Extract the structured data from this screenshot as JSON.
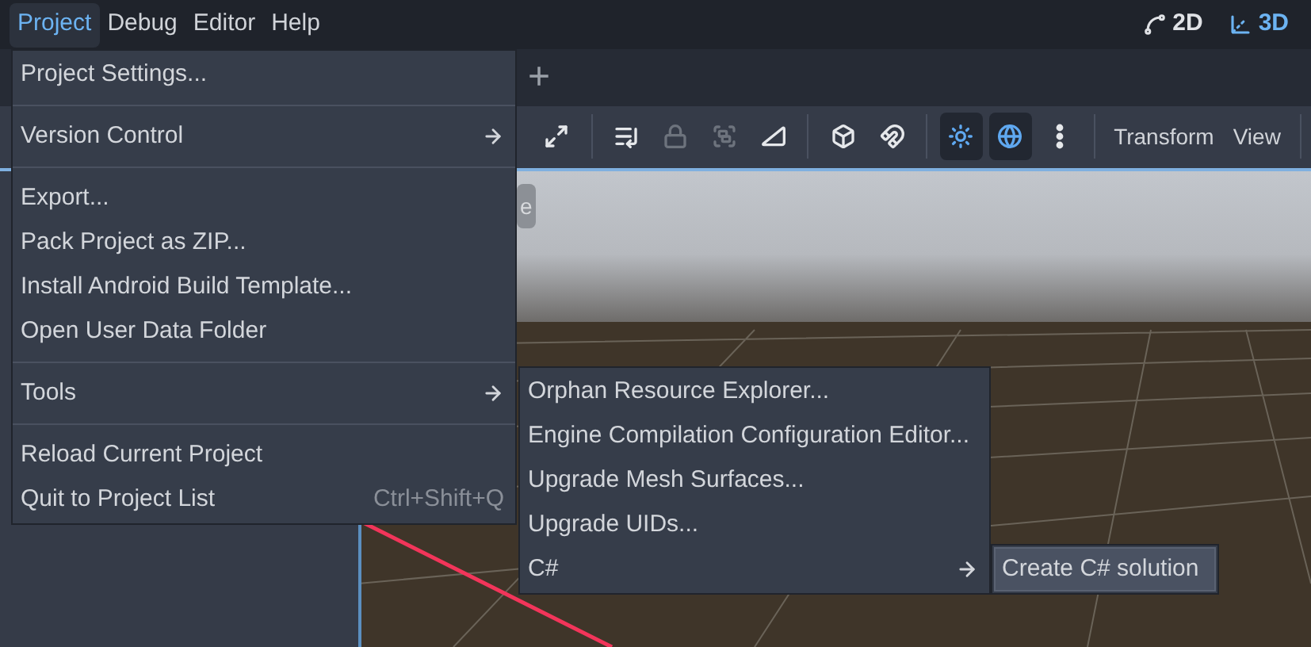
{
  "menubar": {
    "items": [
      {
        "label": "Project",
        "selected": true
      },
      {
        "label": "Debug",
        "selected": false
      },
      {
        "label": "Editor",
        "selected": false
      },
      {
        "label": "Help",
        "selected": false
      }
    ]
  },
  "view_modes": [
    {
      "label": "2D",
      "selected": false
    },
    {
      "label": "3D",
      "selected": true
    }
  ],
  "tab_strip": {
    "add_label": "+"
  },
  "toolbar": {
    "tool_groups": [
      [
        {
          "kind": "expand",
          "on": false,
          "disabled": false
        }
      ],
      [
        {
          "kind": "select-list",
          "on": false,
          "disabled": false
        },
        {
          "kind": "lock",
          "on": false,
          "disabled": true
        },
        {
          "kind": "group",
          "on": false,
          "disabled": true
        },
        {
          "kind": "ruler",
          "on": false,
          "disabled": false
        }
      ],
      [
        {
          "kind": "cube",
          "on": false,
          "disabled": false
        },
        {
          "kind": "magnet",
          "on": false,
          "disabled": false
        }
      ],
      [
        {
          "kind": "sun",
          "on": true,
          "disabled": false
        },
        {
          "kind": "globe",
          "on": true,
          "disabled": false
        },
        {
          "kind": "more",
          "on": false,
          "disabled": false
        }
      ]
    ],
    "menus": [
      "Transform",
      "View"
    ]
  },
  "viewport": {
    "label": "e"
  },
  "project_menu": {
    "items": [
      {
        "kind": "item",
        "label": "Project Settings..."
      },
      {
        "kind": "separator"
      },
      {
        "kind": "submenu",
        "label": "Version Control"
      },
      {
        "kind": "separator"
      },
      {
        "kind": "item",
        "label": "Export..."
      },
      {
        "kind": "item",
        "label": "Pack Project as ZIP..."
      },
      {
        "kind": "item",
        "label": "Install Android Build Template..."
      },
      {
        "kind": "item",
        "label": "Open User Data Folder"
      },
      {
        "kind": "separator"
      },
      {
        "kind": "submenu",
        "label": "Tools"
      },
      {
        "kind": "separator"
      },
      {
        "kind": "item",
        "label": "Reload Current Project"
      },
      {
        "kind": "item",
        "label": "Quit to Project List",
        "shortcut": "Ctrl+Shift+Q"
      }
    ]
  },
  "tools_menu": {
    "items": [
      {
        "kind": "item",
        "label": "Orphan Resource Explorer..."
      },
      {
        "kind": "item",
        "label": "Engine Compilation Configuration Editor..."
      },
      {
        "kind": "item",
        "label": "Upgrade Mesh Surfaces..."
      },
      {
        "kind": "item",
        "label": "Upgrade UIDs..."
      },
      {
        "kind": "submenu",
        "label": "C#"
      }
    ]
  },
  "csharp_menu": {
    "items": [
      {
        "kind": "item",
        "label": "Create C# solution",
        "selected": true
      }
    ]
  }
}
